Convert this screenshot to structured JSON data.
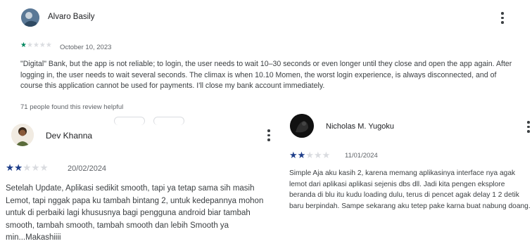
{
  "colors": {
    "star_filled": "#1f3f8a",
    "star_filled_green": "#01875f",
    "star_empty": "#dadce0"
  },
  "review1": {
    "author": "Alvaro Basily",
    "rating": 1,
    "date": "October 10, 2023",
    "text": "\"Digital\" Bank, but the app is not reliable; to login, the user needs to wait 10–30 seconds or even longer until they close and open the app again. After logging in, the user needs to wait several seconds. The climax is when 10.10 Momen, the worst login experience, is always disconnected, and of course this application cannot be used for payments. I'll close my bank account immediately.",
    "helpful": "71 people found this review helpful"
  },
  "review2": {
    "author": "Dev Khanna",
    "rating": 2,
    "date": "20/02/2024",
    "text": "Setelah Update, Aplikasi sedikit smooth, tapi ya tetap sama sih masih Lemot, tapi nggak papa ku tambah bintang 2, untuk kedepannya mohon untuk di perbaiki lagi khususnya bagi pengguna android biar tambah smooth, tambah smooth, tambah smooth dan lebih Smooth ya min...Makashiiii"
  },
  "review3": {
    "author": "Nicholas M. Yugoku",
    "rating": 2,
    "date": "11/01/2024",
    "text": "Simple Aja aku kasih 2, karena memang aplikasinya interface nya agak lemot dari aplikasi aplikasi sejenis dbs dll. Jadi kita pengen eksplore beranda di blu itu kudu loading dulu, terus di pencet agak delay 1 2 detik baru berpindah. Sampe sekarang aku tetep pake karna buat nabung doang."
  }
}
